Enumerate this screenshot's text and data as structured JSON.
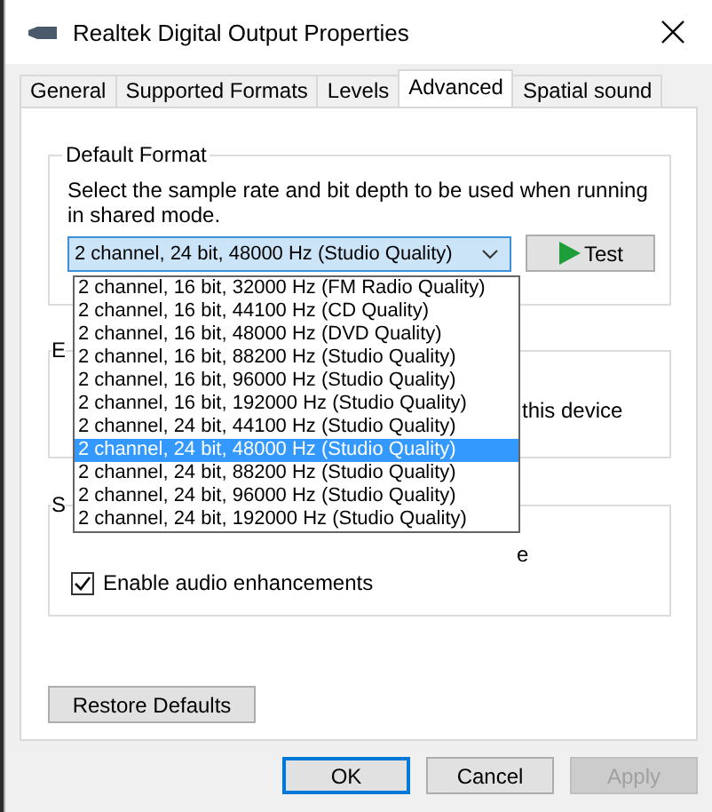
{
  "window": {
    "title": "Realtek Digital Output Properties"
  },
  "tabs": [
    {
      "label": "General",
      "selected": false
    },
    {
      "label": "Supported Formats",
      "selected": false
    },
    {
      "label": "Levels",
      "selected": false
    },
    {
      "label": "Advanced",
      "selected": true
    },
    {
      "label": "Spatial sound",
      "selected": false
    }
  ],
  "default_format": {
    "label": "Default Format",
    "description": "Select the sample rate and bit depth to be used when running in shared mode.",
    "combo_value": "2 channel, 24 bit, 48000 Hz (Studio Quality)",
    "test_button": "Test",
    "options": [
      {
        "label": "2 channel, 16 bit, 32000 Hz (FM Radio Quality)",
        "selected": false
      },
      {
        "label": "2 channel, 16 bit, 44100 Hz (CD Quality)",
        "selected": false
      },
      {
        "label": "2 channel, 16 bit, 48000 Hz (DVD Quality)",
        "selected": false
      },
      {
        "label": "2 channel, 16 bit, 88200 Hz (Studio Quality)",
        "selected": false
      },
      {
        "label": "2 channel, 16 bit, 96000 Hz (Studio Quality)",
        "selected": false
      },
      {
        "label": "2 channel, 16 bit, 192000 Hz (Studio Quality)",
        "selected": false
      },
      {
        "label": "2 channel, 24 bit, 44100 Hz (Studio Quality)",
        "selected": false
      },
      {
        "label": "2 channel, 24 bit, 48000 Hz (Studio Quality)",
        "selected": true
      },
      {
        "label": "2 channel, 24 bit, 88200 Hz (Studio Quality)",
        "selected": false
      },
      {
        "label": "2 channel, 24 bit, 96000 Hz (Studio Quality)",
        "selected": false
      },
      {
        "label": "2 channel, 24 bit, 192000 Hz (Studio Quality)",
        "selected": false
      }
    ]
  },
  "exclusive_group": {
    "label": "E",
    "text": "this device"
  },
  "signal_group": {
    "label": "S",
    "text": "e",
    "checkbox": {
      "label": "Enable audio enhancements",
      "checked": true
    }
  },
  "restore_button": "Restore Defaults",
  "buttons": [
    {
      "label": "OK",
      "kind": "default"
    },
    {
      "label": "Cancel",
      "kind": "normal"
    },
    {
      "label": "Apply",
      "kind": "disabled"
    }
  ]
}
